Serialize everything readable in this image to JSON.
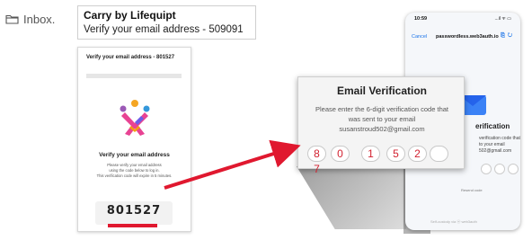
{
  "inbox": {
    "label": "Inbox."
  },
  "subject": {
    "from": "Carry by Lifequipt",
    "line": "Verify your email address - 509091"
  },
  "email": {
    "heading": "Verify your email address - 801527",
    "title": "Verify your email address",
    "desc1": "Please verify your email address",
    "desc2": "using the code below to log in.",
    "desc3": "This verification code will expire in 5 minutes.",
    "code": "801527"
  },
  "phone": {
    "time": "10:59",
    "status_right": "...il ᯤ ▭",
    "cancel": "Cancel",
    "url": "passwordless.web3auth.io",
    "title": "erification",
    "desc1": "verification code that",
    "desc2": "to your email",
    "desc3": "502@gmail.com",
    "resend": "Resend code",
    "footer": "Self-custody via ⓦ web3auth"
  },
  "verification": {
    "title": "Email Verification",
    "desc1": "Please enter the 6-digit verification code that",
    "desc2": "was sent to your email",
    "email": "susanstroud502@gmail.com",
    "digits": [
      "8",
      "0",
      "1",
      "5",
      "2",
      "",
      "7"
    ]
  },
  "colors": {
    "accent_red": "#e0182f",
    "digit_red": "#d2202f",
    "link_blue": "#1a73e8"
  }
}
